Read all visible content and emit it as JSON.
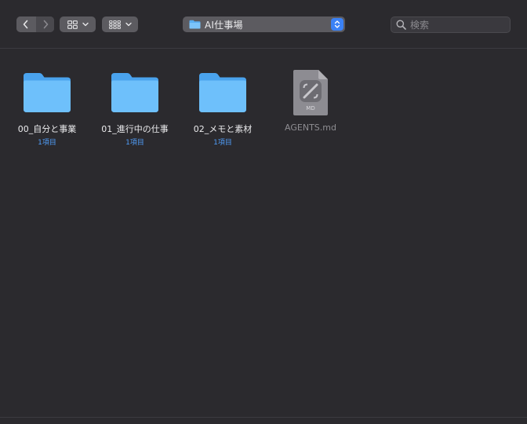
{
  "toolbar": {
    "back_icon": "chevron-left-icon",
    "forward_icon": "chevron-right-icon",
    "icon_view_icon": "grid-view-icon",
    "group_view_icon": "group-grid-icon",
    "path_title": "AI仕事場",
    "search_placeholder": "検索",
    "accent": "#3b82f6"
  },
  "items": [
    {
      "name": "00_自分と事業",
      "count": "1項目",
      "kind": "folder"
    },
    {
      "name": "01_進行中の仕事",
      "count": "1項目",
      "kind": "folder"
    },
    {
      "name": "02_メモと素材",
      "count": "1項目",
      "kind": "folder"
    },
    {
      "name": "AGENTS.md",
      "count": "",
      "kind": "file",
      "file_badge": "MD"
    }
  ]
}
